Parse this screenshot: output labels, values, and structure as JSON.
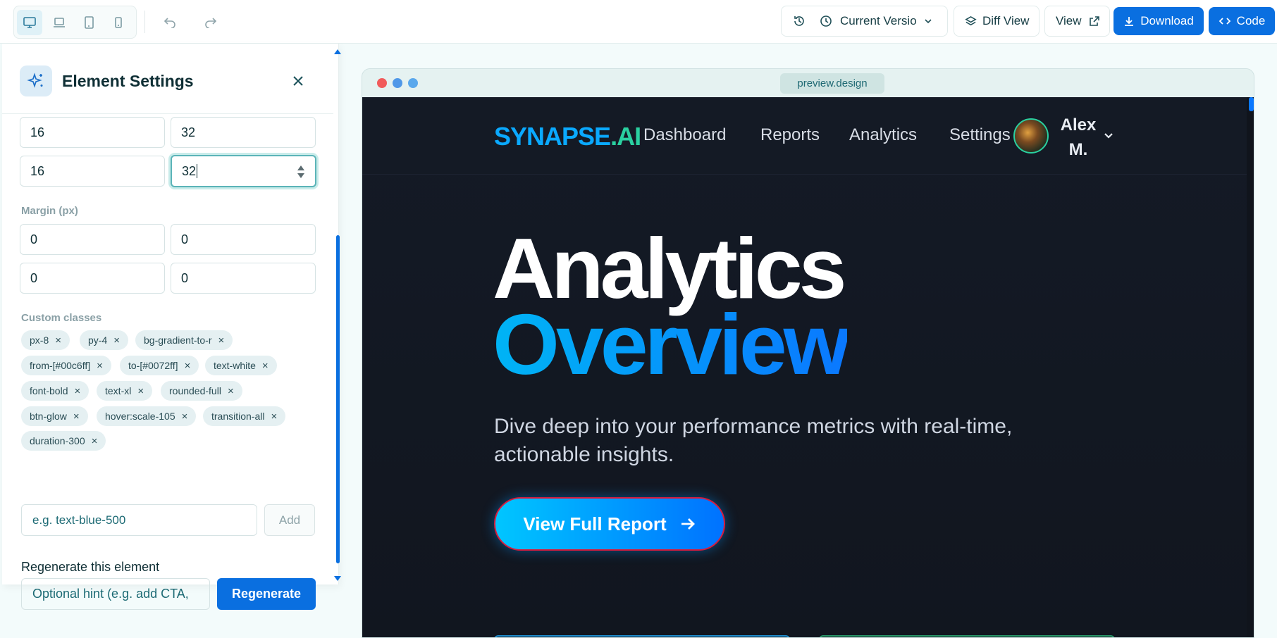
{
  "toolbar": {
    "devices": [
      "desktop",
      "laptop",
      "tablet",
      "mobile"
    ],
    "version_label": "Current Version",
    "diff_label": "Diff View",
    "view_label": "View",
    "download_label": "Download",
    "code_label": "Code"
  },
  "panel": {
    "title": "Element Settings",
    "padding_values": [
      "16",
      "32",
      "16",
      "32"
    ],
    "margin_label": "Margin (px)",
    "margin_values": [
      "0",
      "0",
      "0",
      "0"
    ],
    "classes_label": "Custom classes",
    "classes": [
      "px-8",
      "py-4",
      "bg-gradient-to-r",
      "from-[#00c6ff]",
      "to-[#0072ff]",
      "text-white",
      "font-bold",
      "text-xl",
      "rounded-full",
      "btn-glow",
      "hover:scale-105",
      "transition-all",
      "duration-300"
    ],
    "class_placeholder": "e.g. text-blue-500",
    "add_label": "Add",
    "regenerate_heading": "Regenerate this element",
    "hint_placeholder": "Optional hint (e.g. add CTA,",
    "regenerate_label": "Regenerate"
  },
  "preview": {
    "url": "preview.design",
    "logo_part1": "SYNAPSE",
    "logo_part2": ".AI",
    "nav": [
      "Dashboard",
      "Reports",
      "Analytics",
      "Settings"
    ],
    "user": "Alex M.",
    "headline_1": "Analytics",
    "headline_2": "Overview",
    "subtext": "Dive deep into your performance metrics with real-time, actionable insights.",
    "cta_label": "View Full Report"
  },
  "colors": {
    "primary": "#0a6fe0",
    "logo_blue": "#0aa9ff",
    "logo_green": "#2ad0a0",
    "cta_from": "#00c6ff",
    "cta_to": "#0072ff"
  }
}
